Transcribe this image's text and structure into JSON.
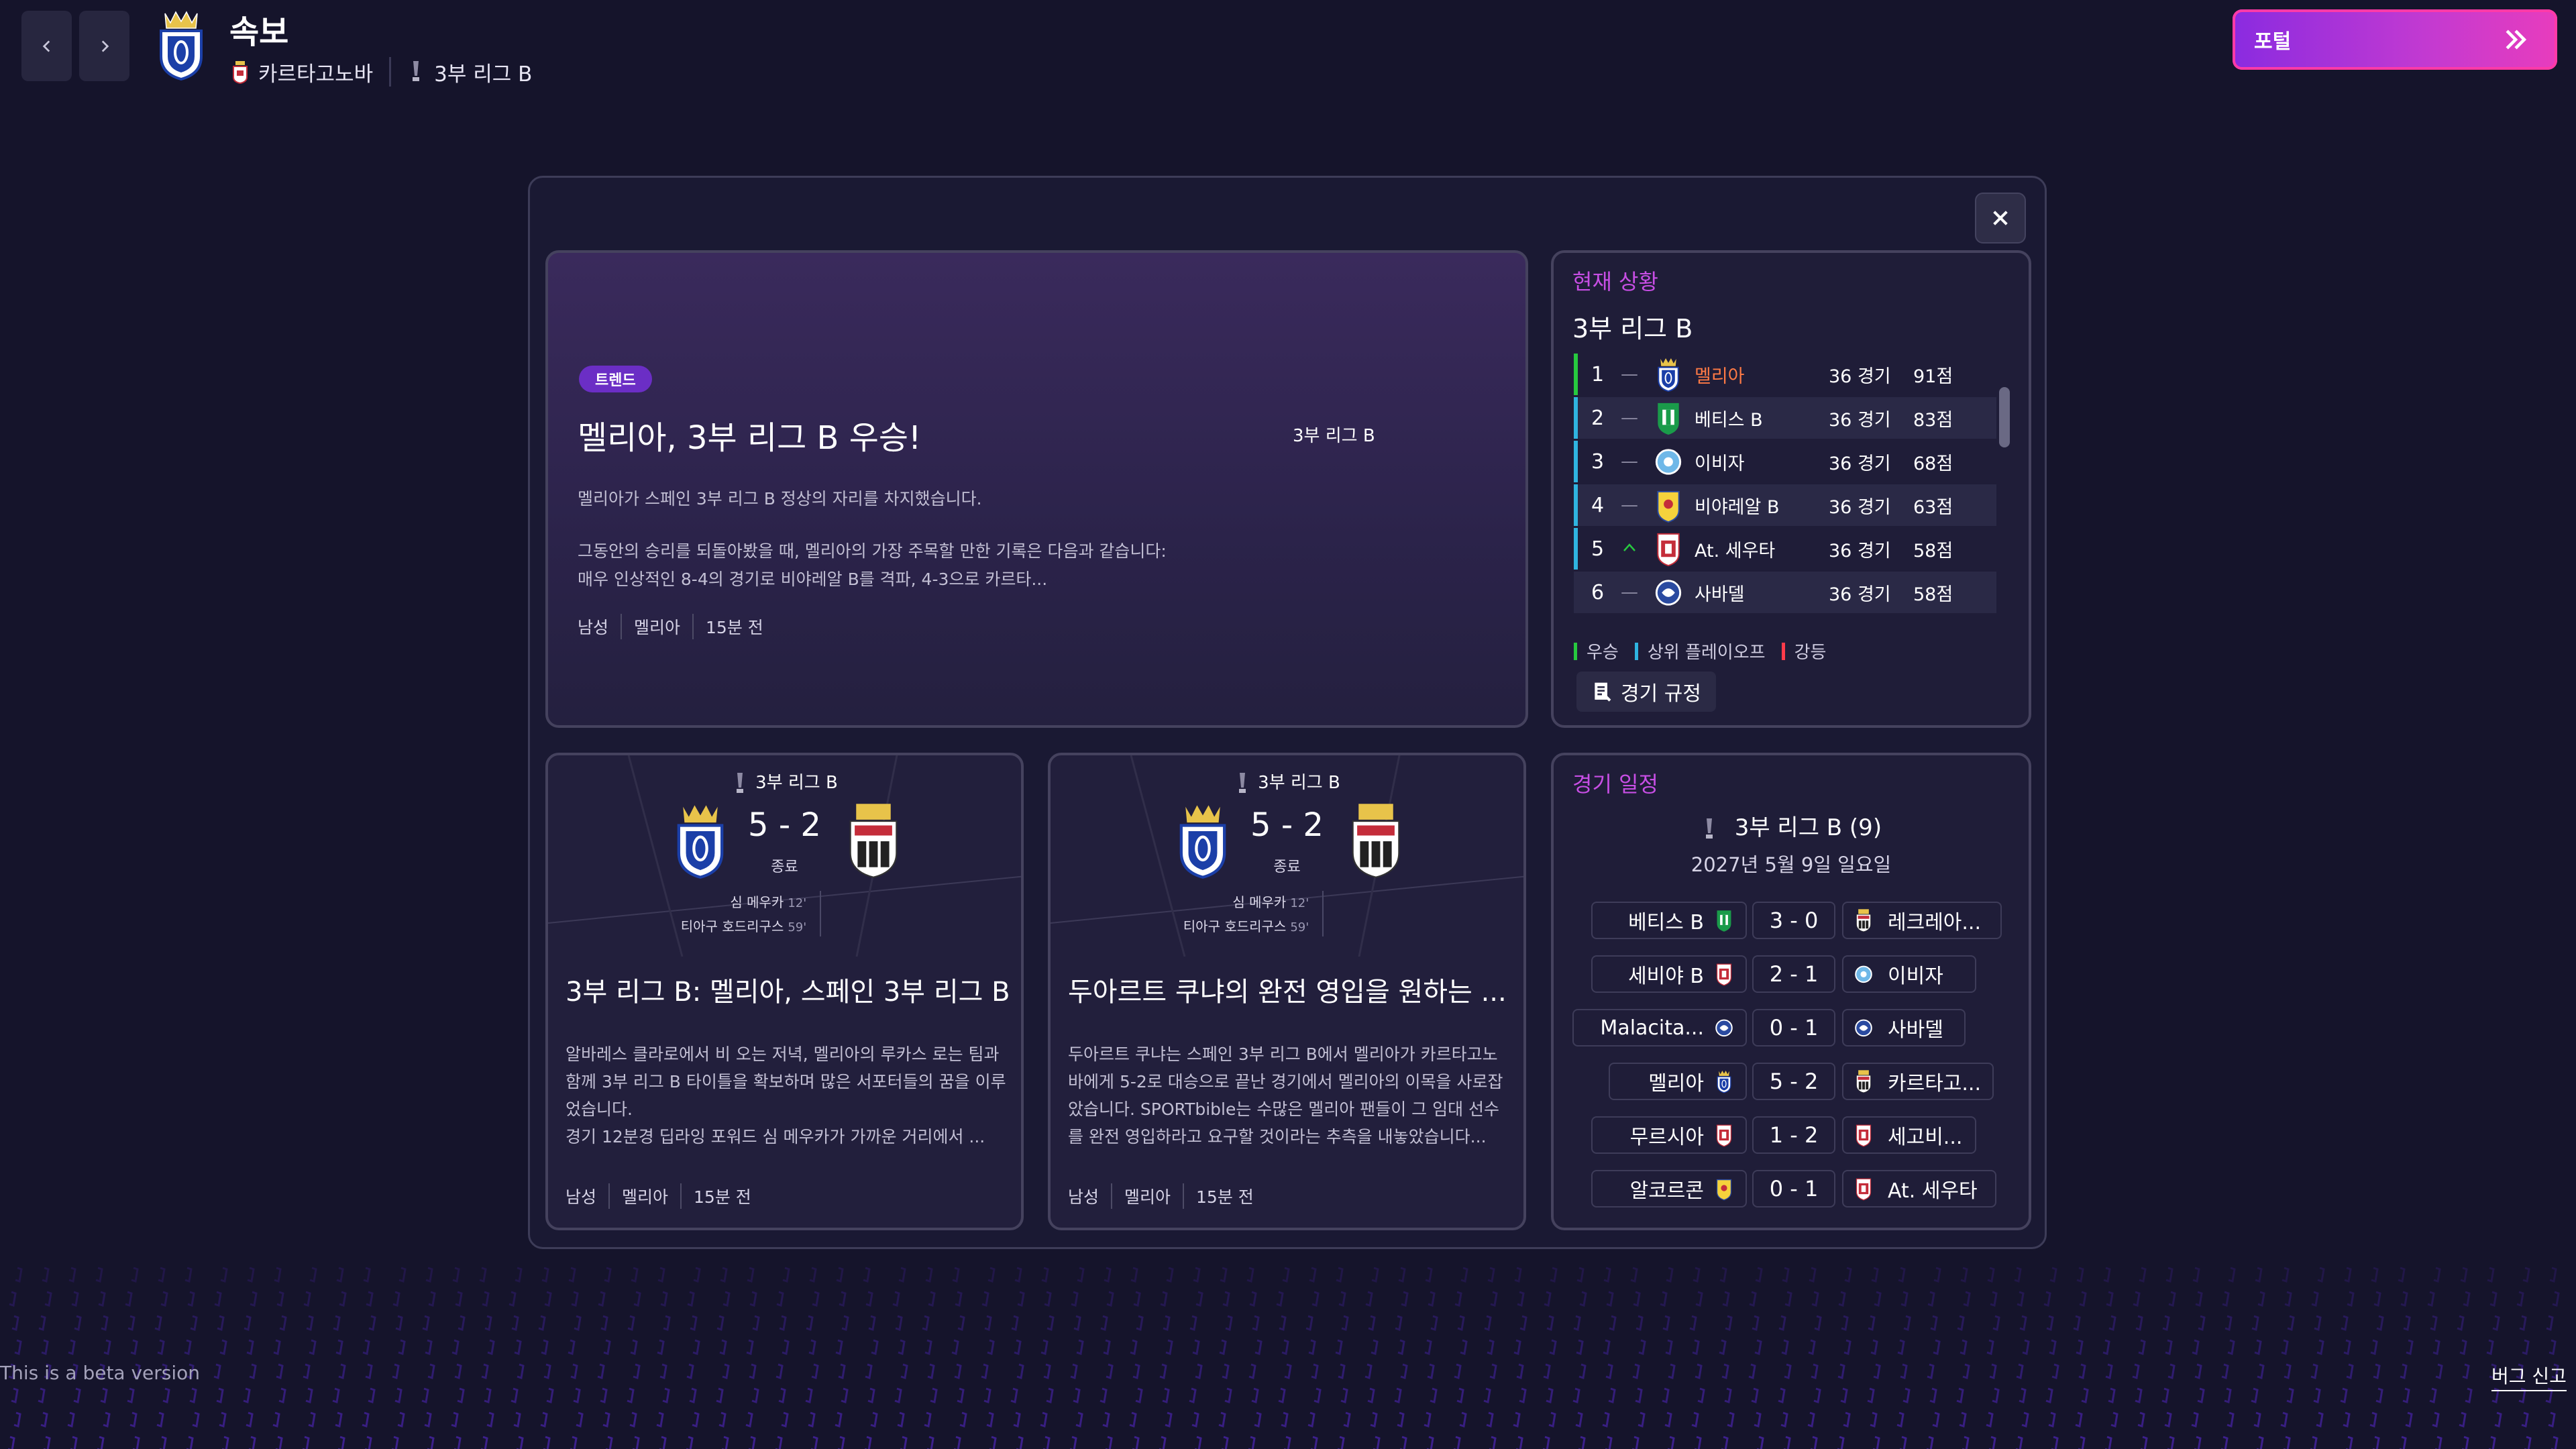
{
  "header": {
    "title": "속보",
    "club": "카르타고노바",
    "league": "3부 리그 B",
    "portal_label": "포털"
  },
  "hero": {
    "badge": "트렌드",
    "title": "멜리아, 3부 리그 B 우승!",
    "league": "3부 리그 B",
    "p1": "멜리아가 스페인 3부 리그 B 정상의 자리를 차지했습니다.",
    "p2": "그동안의 승리를 되돌아봤을 때, 멜리아의 가장 주목할 만한 기록은 다음과 같습니다: 매우 인상적인 8-4의 경기로 비야레알 B를 격파, 4-3으로 카르타...",
    "meta": [
      "남성",
      "멜리아",
      "15분 전"
    ]
  },
  "standings": {
    "label": "현재 상황",
    "title": "3부 리그 B",
    "rows": [
      {
        "pos": "1",
        "move": "—",
        "team": "멜리아",
        "games": "36 경기",
        "pts": "91점"
      },
      {
        "pos": "2",
        "move": "—",
        "team": "베티스 B",
        "games": "36 경기",
        "pts": "83점"
      },
      {
        "pos": "3",
        "move": "—",
        "team": "이비자",
        "games": "36 경기",
        "pts": "68점"
      },
      {
        "pos": "4",
        "move": "—",
        "team": "비야레알 B",
        "games": "36 경기",
        "pts": "63점"
      },
      {
        "pos": "5",
        "move": "^",
        "team": "At. 세우타",
        "games": "36 경기",
        "pts": "58점"
      },
      {
        "pos": "6",
        "move": "—",
        "team": "사바델",
        "games": "36 경기",
        "pts": "58점"
      }
    ],
    "legend": [
      "우승",
      "상위 플레이오프",
      "강등"
    ],
    "rules_label": "경기 규정",
    "colors": {
      "champion": "#27c93f",
      "playoff": "#2fb4e0",
      "relegation": "#ff3b4a",
      "highlight": "#ff7a45"
    }
  },
  "cards": [
    {
      "league": "3부 리그 B",
      "score": "5 - 2",
      "status": "종료",
      "scorer1": "심 메우카",
      "min1": "12'",
      "scorer2": "티아구 호드리구스",
      "min2": "59'",
      "title": "3부 리그 B: 멜리아, 스페인 3부 리그 B...",
      "body": "알바레스 클라로에서 비 오는 저녁, 멜리아의 루카스 로는 팀과 함께 3부 리그 B 타이틀을 확보하며 많은 서포터들의 꿈을 이루었습니다.\n경기 12분경 딥라잉 포워드 심 메우카가 가까운 거리에서 ...",
      "meta": [
        "남성",
        "멜리아",
        "15분 전"
      ]
    },
    {
      "league": "3부 리그 B",
      "score": "5 - 2",
      "status": "종료",
      "scorer1": "심 메우카",
      "min1": "12'",
      "scorer2": "티아구 호드리구스",
      "min2": "59'",
      "title": "두아르트 쿠냐의 완전 영입을 원하는 ...",
      "body": "두아르트 쿠냐는 스페인 3부 리그 B에서 멜리아가 카르타고노바에게 5-2로 대승으로 끝난 경기에서 멜리아의 이목을 사로잡았습니다. SPORTbible는 수많은 멜리아 팬들이 그 임대 선수를 완전 영입하라고 요구할 것이라는 추측을 내놓았습니다...",
      "meta": [
        "남성",
        "멜리아",
        "15분 전"
      ]
    }
  ],
  "fixtures": {
    "label": "경기 일정",
    "league": "3부 리그 B (9)",
    "date": "2027년 5월 9일 일요일",
    "rows": [
      {
        "home": "베티스 B",
        "score": "3 - 0",
        "away": "레크레아..."
      },
      {
        "home": "세비야 B",
        "score": "2 - 1",
        "away": "이비자"
      },
      {
        "home": "Malacita...",
        "score": "0 - 1",
        "away": "사바델"
      },
      {
        "home": "멜리아",
        "score": "5 - 2",
        "away": "카르타고..."
      },
      {
        "home": "무르시아",
        "score": "1 - 2",
        "away": "세고비..."
      },
      {
        "home": "알코르콘",
        "score": "0 - 1",
        "away": "At. 세우타"
      }
    ]
  },
  "footer": {
    "beta": "This is a beta version",
    "bug_report": "버그 신고"
  }
}
